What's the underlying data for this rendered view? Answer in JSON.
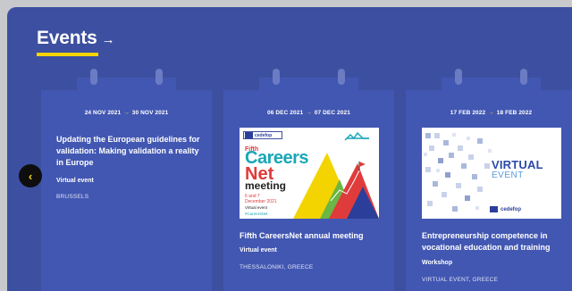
{
  "section": {
    "title": "Events",
    "title_arrow": "→"
  },
  "carousel": {
    "prev_icon": "chevron-left-icon",
    "prev_glyph": "‹"
  },
  "events": [
    {
      "date_start": "24 NOV 2021",
      "date_arrow": "→",
      "date_end": "30 NOV 2021",
      "title": "Updating the European guidelines for validation: Making validation a reality in Europe",
      "type": "Virtual event",
      "location": "BRUSSELS"
    },
    {
      "date_start": "06 DEC 2021",
      "date_arrow": "→",
      "date_end": "07 DEC 2021",
      "title": "Fifth CareersNet annual meeting",
      "type": "Virtual event",
      "location": "THESSALONIKI, GREECE",
      "image": {
        "logo_text": "cedefop",
        "heading_1": "Fifth",
        "heading_2": "Careers",
        "heading_3": "Net",
        "heading_4": "meeting",
        "dates_1": "6 and 7",
        "dates_2": "December 2021",
        "mode": "Virtual event",
        "hashtag": "#CareersNet"
      }
    },
    {
      "date_start": "17 FEB 2022",
      "date_arrow": "→",
      "date_end": "18 FEB 2022",
      "title": "Entrepreneurship competence in vocational education and training",
      "type": "Workshop",
      "location": "VIRTUAL EVENT, GREECE",
      "image": {
        "line_1": "VIRTUAL",
        "line_2": "EVENT",
        "logo_text": "cedefop"
      }
    }
  ],
  "colors": {
    "panel": "#3d4fa0",
    "card": "#4257b2",
    "accent": "#f5d400"
  }
}
